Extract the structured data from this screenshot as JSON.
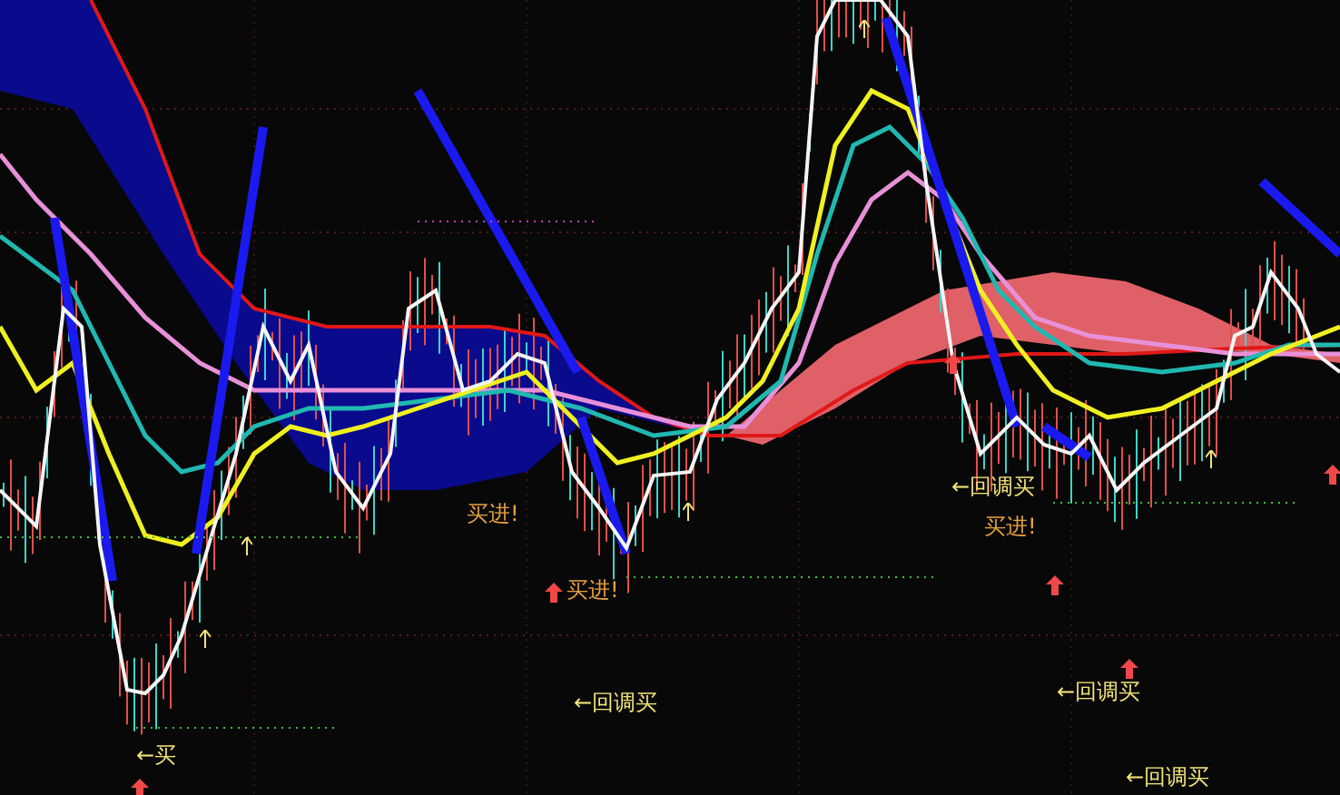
{
  "chart": {
    "annotations": [
      {
        "text": "买进!",
        "kind": "buy"
      },
      {
        "text": "买进!",
        "kind": "buy"
      },
      {
        "text": "←回调买",
        "kind": "pullback"
      },
      {
        "text": "←买",
        "kind": "pullback"
      },
      {
        "text": "←回调买",
        "kind": "pullback"
      },
      {
        "text": "买进!",
        "kind": "buy"
      },
      {
        "text": "←回调买",
        "kind": "pullback"
      },
      {
        "text": "←回调买",
        "kind": "pullback"
      }
    ]
  }
}
